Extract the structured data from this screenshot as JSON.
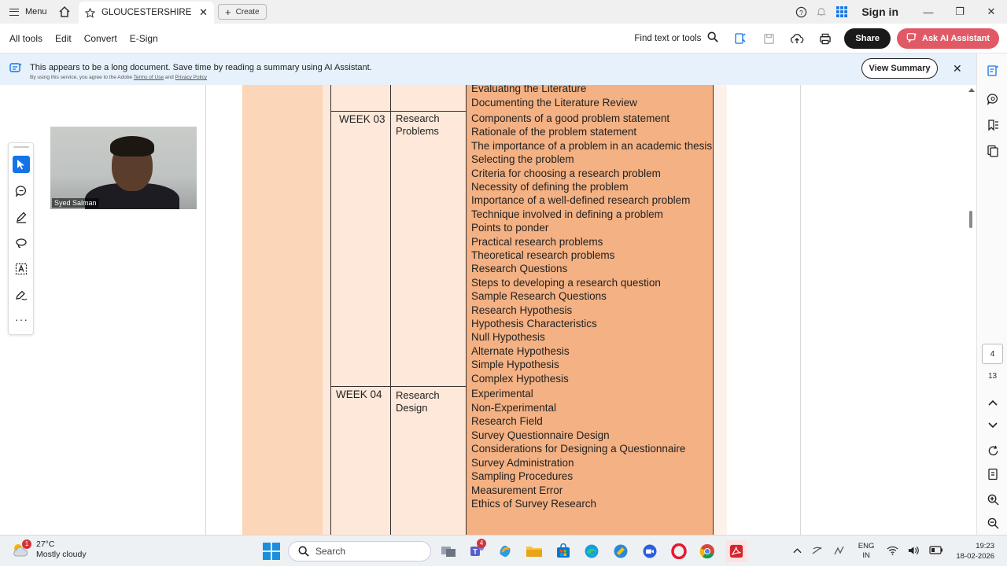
{
  "titlebar": {
    "menu_label": "Menu",
    "tab_title": "GLOUCESTERSHIRE BU...",
    "create_label": "Create",
    "sign_in": "Sign in"
  },
  "toolbar": {
    "items": [
      "All tools",
      "Edit",
      "Convert",
      "E-Sign"
    ],
    "find_text": "Find text or tools",
    "share_label": "Share",
    "ai_label": "Ask AI Assistant"
  },
  "banner": {
    "text": "This appears to be a long document. Save time by reading a summary using AI Assistant.",
    "sub_prefix": "By using this service, you agree to the Adobe ",
    "terms": "Terms of Use",
    "sub_and": " and ",
    "privacy": "Privacy Policy",
    "view_summary": "View Summary"
  },
  "video": {
    "name": "Syed Salman"
  },
  "page_nav": {
    "current": "4",
    "total": "13"
  },
  "document": {
    "top_items": [
      "Evaluating the Literature",
      "Documenting the Literature Review"
    ],
    "week03": {
      "week": "WEEK 03",
      "topic_line1": "Research",
      "topic_line2": "Problems",
      "items": [
        "Components of a good problem statement",
        "Rationale of the problem statement",
        "The importance of a problem in an academic thesis",
        "Selecting the problem",
        "Criteria for choosing a research problem",
        "Necessity of defining the problem",
        "Importance of a well-defined research problem",
        "Technique involved in defining a problem",
        "Points to ponder",
        "Practical research problems",
        "Theoretical research problems",
        "Research Questions",
        "Steps to developing a research question",
        "Sample Research Questions",
        "Research Hypothesis",
        "Hypothesis Characteristics",
        "Null Hypothesis",
        "Alternate Hypothesis",
        "Simple Hypothesis",
        "Complex Hypothesis"
      ]
    },
    "week04": {
      "week": "WEEK 04",
      "topic_line1": "Research",
      "topic_line2": "Design",
      "items": [
        "Experimental",
        "Non-Experimental",
        "Research Field",
        "Survey Questionnaire Design",
        "Considerations for Designing a Questionnaire",
        "Survey Administration",
        "Sampling Procedures",
        "Measurement Error",
        "Ethics of Survey Research"
      ]
    }
  },
  "taskbar": {
    "weather_temp": "27°C",
    "weather_cond": "Mostly cloudy",
    "weather_badge": "1",
    "search_label": "Search",
    "teams_badge": "4",
    "lang_line1": "ENG",
    "lang_line2": "IN",
    "time": "19:23",
    "date": "18-02-2026"
  }
}
